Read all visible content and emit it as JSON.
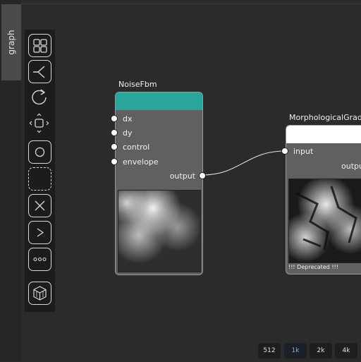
{
  "side_tab": {
    "label": "graph"
  },
  "toolbar": {
    "tools": [
      {
        "name": "layout-grid-icon"
      },
      {
        "name": "branch-icon"
      },
      {
        "name": "refresh-icon"
      },
      {
        "name": "move-icon"
      },
      {
        "name": "circle-icon"
      },
      {
        "name": "dashed-select-icon"
      },
      {
        "name": "delete-x-icon"
      },
      {
        "name": "chevron-right-icon"
      },
      {
        "name": "more-dots-icon"
      },
      {
        "name": "cube-icon"
      }
    ]
  },
  "nodes": {
    "noise_fbm": {
      "title": "NoiseFbm",
      "header_color": "#2aa69c",
      "inputs": [
        "dx",
        "dy",
        "control",
        "envelope"
      ],
      "output": "output"
    },
    "morph_grad": {
      "title": "MorphologicalGrad",
      "header_color": "#ffffff",
      "input": "input",
      "output": "outpu",
      "deprecated": "!!! Deprecated !!!"
    }
  },
  "resolution": {
    "options": [
      "512",
      "1k",
      "2k",
      "4k"
    ],
    "selected": "1k"
  }
}
